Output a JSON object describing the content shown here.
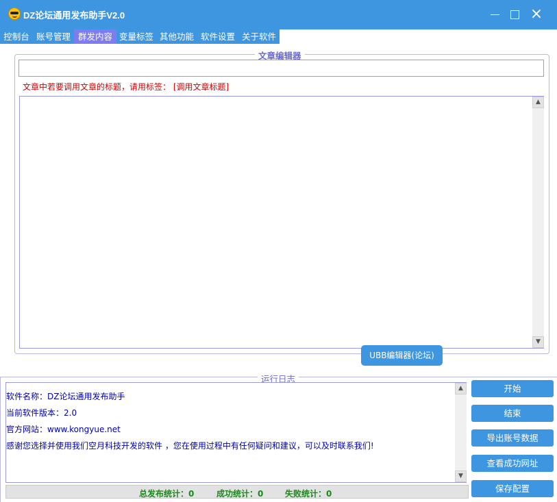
{
  "window": {
    "title": "DZ论坛通用发布助手V2.0",
    "icon": "sunglasses-smiley-icon",
    "controls": {
      "minimize": "minimize-icon",
      "maximize": "maximize-icon",
      "close": "×"
    }
  },
  "menu": {
    "tabs": [
      {
        "label": "控制台"
      },
      {
        "label": "账号管理"
      },
      {
        "label": "群发内容",
        "active": true
      },
      {
        "label": "变量标签"
      },
      {
        "label": "其他功能"
      },
      {
        "label": "软件设置"
      },
      {
        "label": "关于软件"
      }
    ]
  },
  "editor": {
    "group_title": "文章编辑器",
    "title_value": "",
    "hint": "文章中若要调用文章的标题，请用标签：  [调用文章标题]",
    "content": "",
    "ubb_button": "UBB编辑器(论坛)"
  },
  "log": {
    "group_title": "运行日志",
    "lines": [
      "软件名称：DZ论坛通用发布助手",
      "当前软件版本：2.0",
      "官方网站：www.kongyue.net",
      "感谢您选择并使用我们空月科技开发的软件 ，您在使用过程中有任何疑问和建议，可以及时联系我们!"
    ],
    "stats": {
      "total": "总发布统计：0",
      "success": "成功统计：0",
      "fail": "失败统计：0"
    }
  },
  "actions": {
    "start": "开始",
    "stop": "结束",
    "export": "导出账号数据",
    "view_success": "查看成功网址",
    "save_config": "保存配置"
  },
  "colors": {
    "title_bar": "#3f96e0",
    "active_tab": "#7e7cf0",
    "hint_text": "#d40000",
    "log_text": "#0000b0",
    "stats_text": "#1a8a1a"
  }
}
